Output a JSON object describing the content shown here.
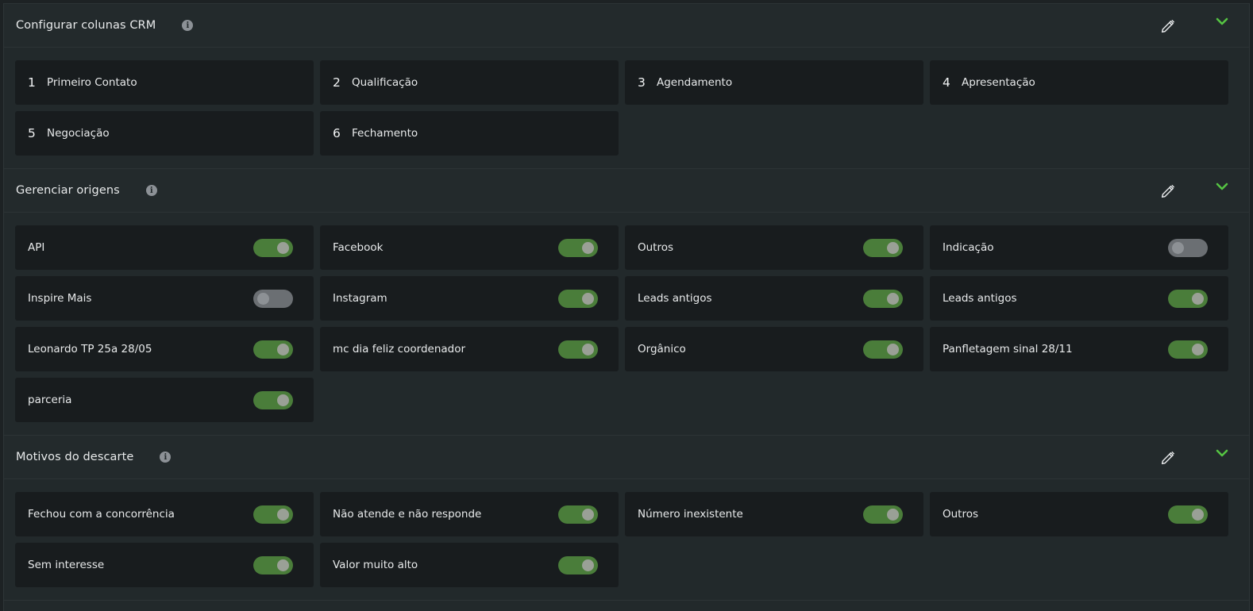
{
  "sections": [
    {
      "title": "Configurar colunas CRM",
      "columns": [
        {
          "num": "1",
          "label": "Primeiro Contato"
        },
        {
          "num": "2",
          "label": "Qualificação"
        },
        {
          "num": "3",
          "label": "Agendamento"
        },
        {
          "num": "4",
          "label": "Apresentação"
        },
        {
          "num": "5",
          "label": "Negociação"
        },
        {
          "num": "6",
          "label": "Fechamento"
        }
      ]
    },
    {
      "title": "Gerenciar origens",
      "items": [
        {
          "label": "API",
          "enabled": true
        },
        {
          "label": "Facebook",
          "enabled": true
        },
        {
          "label": "Outros",
          "enabled": true
        },
        {
          "label": "Indicação",
          "enabled": false
        },
        {
          "label": "Inspire Mais",
          "enabled": false
        },
        {
          "label": "Instagram",
          "enabled": true
        },
        {
          "label": "Leads antigos",
          "enabled": true
        },
        {
          "label": "Leads antigos",
          "enabled": true
        },
        {
          "label": "Leonardo TP 25a 28/05",
          "enabled": true
        },
        {
          "label": "mc dia feliz coordenador",
          "enabled": true
        },
        {
          "label": "Orgânico",
          "enabled": true
        },
        {
          "label": "Panfletagem sinal 28/11",
          "enabled": true
        },
        {
          "label": "parceria",
          "enabled": true
        }
      ]
    },
    {
      "title": "Motivos do descarte",
      "items": [
        {
          "label": "Fechou com a concorrência",
          "enabled": true
        },
        {
          "label": "Não atende e não responde",
          "enabled": true
        },
        {
          "label": "Número inexistente",
          "enabled": true
        },
        {
          "label": "Outros",
          "enabled": true
        },
        {
          "label": "Sem interesse",
          "enabled": true
        },
        {
          "label": "Valor muito alto",
          "enabled": true
        }
      ]
    }
  ],
  "icons": {
    "info": "info-icon",
    "edit": "pencil-edit-icon",
    "collapse": "chevron-down-icon"
  },
  "colors": {
    "accent": "#55c443",
    "toggle_on": "#4a7d3a",
    "toggle_off": "#6b6f73"
  }
}
